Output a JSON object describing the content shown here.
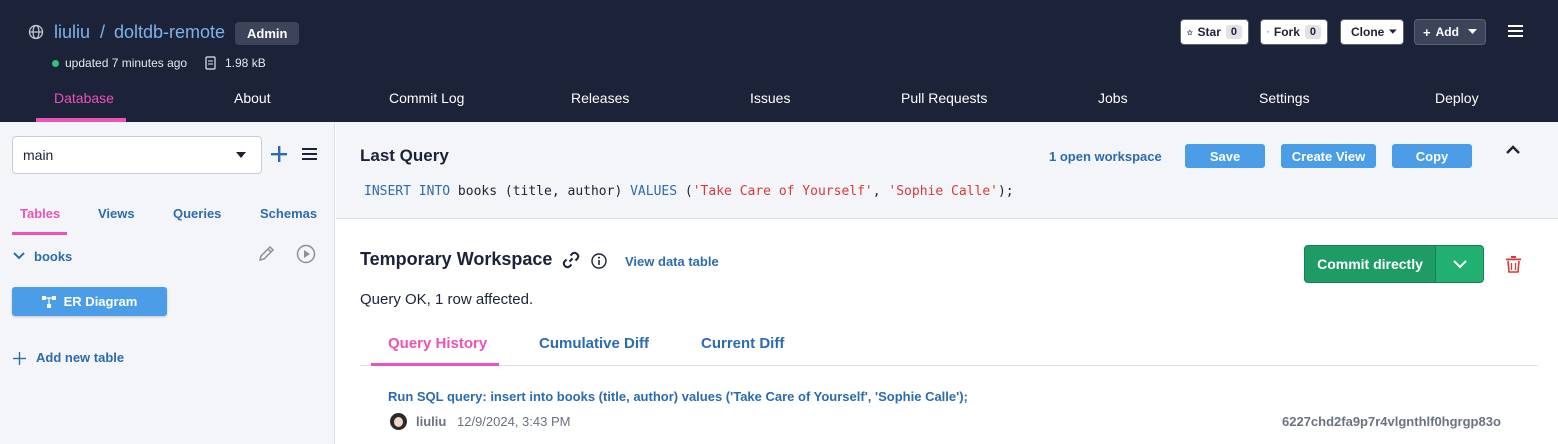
{
  "repo": {
    "owner": "liuliu",
    "separator": "/",
    "name": "doltdb-remote",
    "role_badge": "Admin",
    "updated": "updated 7 minutes ago",
    "size": "1.98 kB"
  },
  "header_buttons": {
    "star_label": "Star",
    "star_count": "0",
    "fork_label": "Fork",
    "fork_count": "0",
    "clone_label": "Clone",
    "add_label": "Add"
  },
  "nav": {
    "database": "Database",
    "about": "About",
    "commit_log": "Commit Log",
    "releases": "Releases",
    "issues": "Issues",
    "pull_requests": "Pull Requests",
    "jobs": "Jobs",
    "settings": "Settings",
    "deploy": "Deploy"
  },
  "sidebar": {
    "branch": "main",
    "tabs": {
      "tables": "Tables",
      "views": "Views",
      "queries": "Queries",
      "schemas": "Schemas"
    },
    "table_name": "books",
    "er_diagram": "ER Diagram",
    "add_new_table": "Add new table"
  },
  "last_query": {
    "title": "Last Query",
    "open_workspace": "1 open workspace",
    "save": "Save",
    "create_view": "Create View",
    "copy": "Copy",
    "sql": {
      "kw1": "INSERT INTO",
      "t1": " books (title, author) ",
      "kw2": "VALUES",
      "t2": " (",
      "s1": "'Take Care of Yourself'",
      "t3": ", ",
      "s2": "'Sophie Calle'",
      "t4": ");"
    }
  },
  "workspace": {
    "title": "Temporary Workspace",
    "view_data_table": "View data table",
    "commit_directly": "Commit directly",
    "result": "Query OK, 1 row affected.",
    "tabs": {
      "query_history": "Query History",
      "cumulative_diff": "Cumulative Diff",
      "current_diff": "Current Diff"
    },
    "history": {
      "message": "Run SQL query: insert into books (title, author) values ('Take Care of Yourself', 'Sophie Calle');",
      "user": "liuliu",
      "date": "12/9/2024, 3:43 PM",
      "hash": "6227chd2fa9p7r4vlgnthlf0hgrgp83o"
    }
  },
  "colors": {
    "header_bg": "#1c2238",
    "accent_pink": "#ec52b8",
    "link_blue": "#2b6cb0",
    "button_blue": "#4b9de8",
    "commit_green": "#1f9c65",
    "danger_red": "#d63a3a"
  },
  "icons": [
    "globe-icon",
    "database-size-icon",
    "star-icon",
    "fork-icon",
    "chevron-down-icon",
    "plus-icon",
    "hamburger-icon",
    "list-icon",
    "pencil-icon",
    "play-icon",
    "er-diagram-icon",
    "chevron-up-icon",
    "link-icon",
    "info-icon",
    "trash-icon",
    "avatar"
  ]
}
